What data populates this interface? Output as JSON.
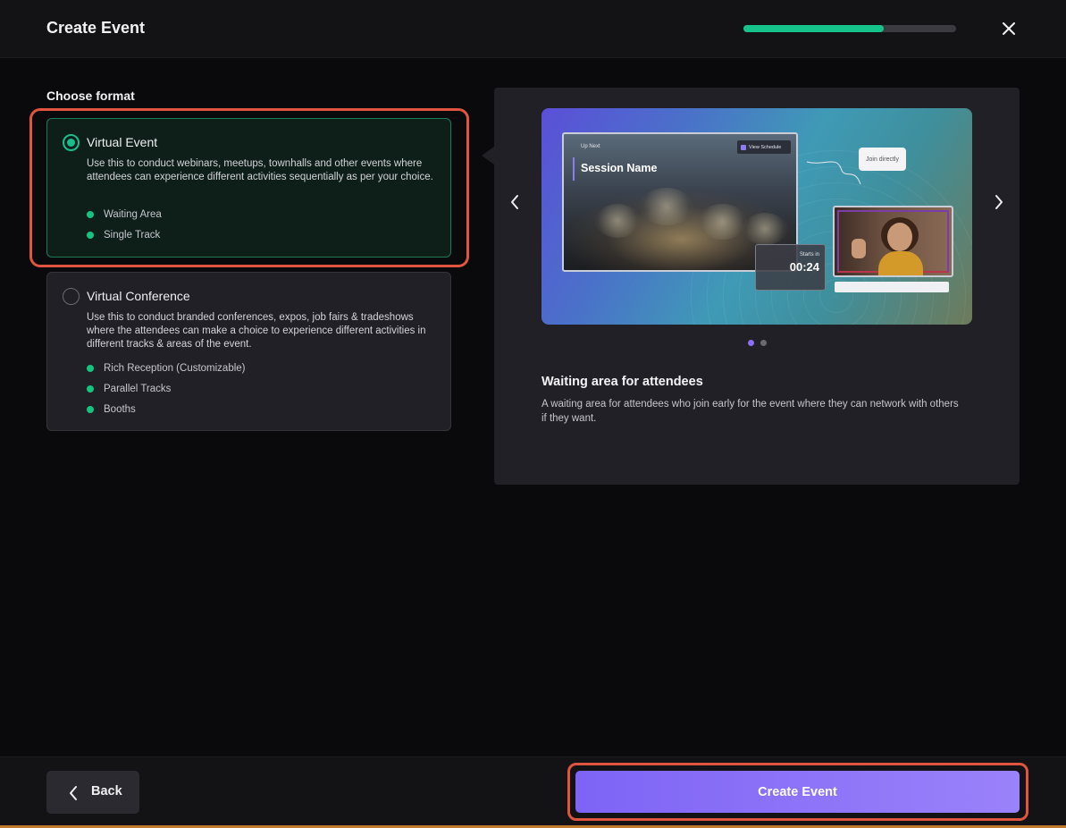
{
  "header": {
    "title": "Create Event",
    "progress_fraction": 0.66
  },
  "format": {
    "section_label": "Choose format",
    "options": [
      {
        "title": "Virtual Event",
        "selected": true,
        "description": "Use this to conduct webinars, meetups, townhalls and other events where attendees can experience different activities sequentially as per your choice.",
        "features": [
          "Waiting Area",
          "Single Track"
        ]
      },
      {
        "title": "Virtual Conference",
        "selected": false,
        "description": "Use this to conduct branded conferences, expos, job fairs & tradeshows where the attendees can make a choice to experience different activities in different tracks & areas of the event.",
        "features": [
          "Rich Reception (Customizable)",
          "Parallel Tracks",
          "Booths"
        ]
      }
    ]
  },
  "preview": {
    "slide": {
      "up_next": "Up Next",
      "session_name": "Session Name",
      "view_schedule": "View Schedule",
      "starts_in": "Starts in",
      "countdown": "00:24",
      "join_directly": "Join directly"
    },
    "carousel": {
      "count": 2,
      "active_index": 0
    },
    "title": "Waiting area for attendees",
    "description": "A waiting area for attendees who join early for the event where they can network with others if they want."
  },
  "footer": {
    "back_label": "Back",
    "create_label": "Create Event"
  },
  "colors": {
    "accent_green": "#16c38a",
    "accent_purple": "#8b6ff6",
    "highlight_red": "#e0553f"
  }
}
